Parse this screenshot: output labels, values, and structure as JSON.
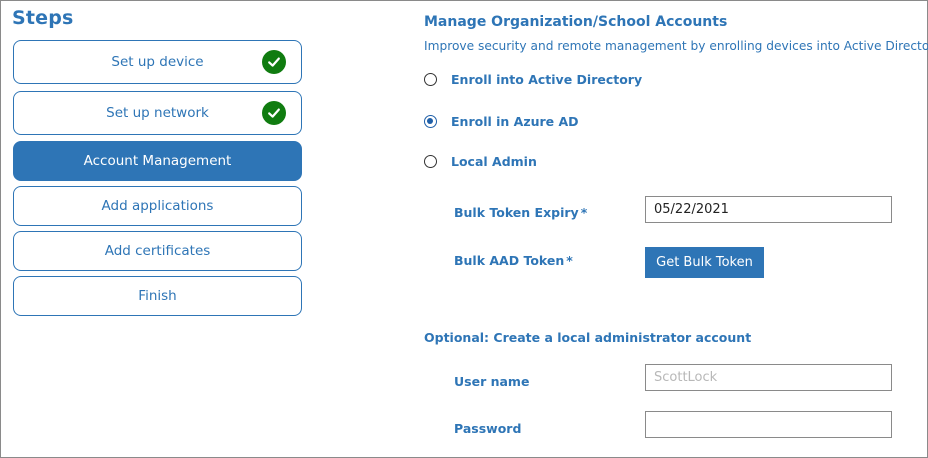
{
  "steps": {
    "title": "Steps",
    "items": [
      {
        "label": "Set up device",
        "complete": true
      },
      {
        "label": "Set up network",
        "complete": true
      },
      {
        "label": "Account Management",
        "active": true
      },
      {
        "label": "Add applications"
      },
      {
        "label": "Add certificates"
      },
      {
        "label": "Finish"
      }
    ]
  },
  "main": {
    "title": "Manage Organization/School Accounts",
    "description": "Improve security and remote management by enrolling devices into Active Directory",
    "options": [
      {
        "label": "Enroll into Active Directory",
        "selected": false
      },
      {
        "label": "Enroll in Azure AD",
        "selected": true
      },
      {
        "label": "Local Admin",
        "selected": false
      }
    ],
    "bulk_token_expiry": {
      "label": "Bulk Token Expiry",
      "required_mark": "*",
      "value": "05/22/2021"
    },
    "bulk_aad_token": {
      "label": "Bulk AAD Token",
      "required_mark": "*",
      "button_label": "Get Bulk Token"
    },
    "optional": {
      "title": "Optional: Create a local administrator account",
      "username": {
        "label": "User name",
        "placeholder": "ScottLock",
        "value": ""
      },
      "password": {
        "label": "Password",
        "value": ""
      }
    }
  },
  "colors": {
    "accent": "#2e75b6",
    "check_green": "#107c10",
    "radio_selected": "#1f5fa8"
  },
  "icons": {
    "complete": "checkmark-icon"
  }
}
